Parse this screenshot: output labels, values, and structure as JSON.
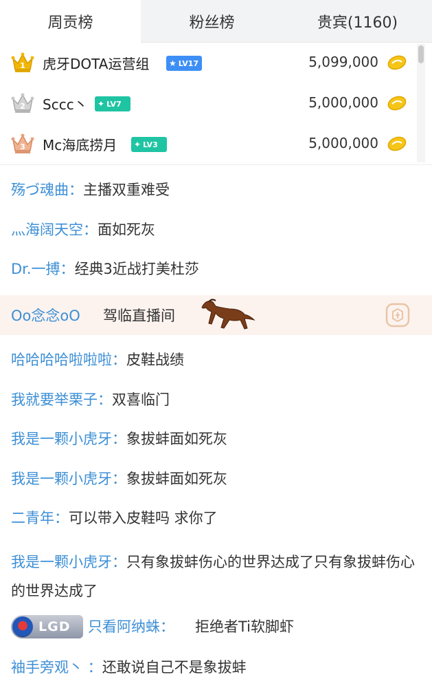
{
  "tabs": [
    {
      "label": "周贡榜"
    },
    {
      "label": "粉丝榜"
    },
    {
      "label": "贵宾(1160)"
    }
  ],
  "ranking": [
    {
      "rank": "1",
      "name": "虎牙DOTA运营组",
      "level": "LV17",
      "amount": "5,099,000",
      "crown_color": "#f2b705"
    },
    {
      "rank": "2",
      "name": "Sccc丶",
      "level": "LV7",
      "amount": "5,000,000",
      "crown_color": "#b8b8b8"
    },
    {
      "rank": "3",
      "name": "Mc海底捞月",
      "level": "LV3",
      "amount": "5,000,000",
      "crown_color": "#e8a27a"
    }
  ],
  "chat": [
    {
      "user": "殇づ魂曲：",
      "text": "主播双重难受"
    },
    {
      "user": "灬海阔天空：",
      "text": "面如死灰"
    },
    {
      "user": "Dr.一搏：",
      "text": "经典3近战打美杜莎"
    },
    {
      "user": "哈哈哈哈啦啦啦：",
      "text": "皮鞋战绩"
    },
    {
      "user": "我就要举栗子：",
      "text": "双喜临门"
    },
    {
      "user": "我是一颗小虎牙：",
      "text": "象拔蚌面如死灰"
    },
    {
      "user": "我是一颗小虎牙：",
      "text": "象拔蚌面如死灰"
    },
    {
      "user": "二青年：",
      "text": "可以带入皮鞋吗 求你了"
    },
    {
      "user": "我是一颗小虎牙：",
      "text": "只有象拔蚌伤心的世界达成了只有象拔蚌伤心的世界达成了"
    },
    {
      "badge": "LGD",
      "user": "只看阿纳蛛：",
      "text": "拒绝者Ti软脚虾"
    },
    {
      "user": "袖手旁观丶 ：",
      "text": "还敢说自己不是象拔蚌"
    }
  ],
  "vip_entry": {
    "user": "Oo念念oO",
    "action": "驾临直播间",
    "badge_icon": "vip-badge-icon",
    "mount_icon": "horse-icon"
  },
  "colors": {
    "username": "#3d8fd6",
    "vip_bg": "#fcf3ef",
    "level_blue": "#3d8ff5",
    "level_teal": "#1fc4a3",
    "coin": "#f5c518"
  }
}
